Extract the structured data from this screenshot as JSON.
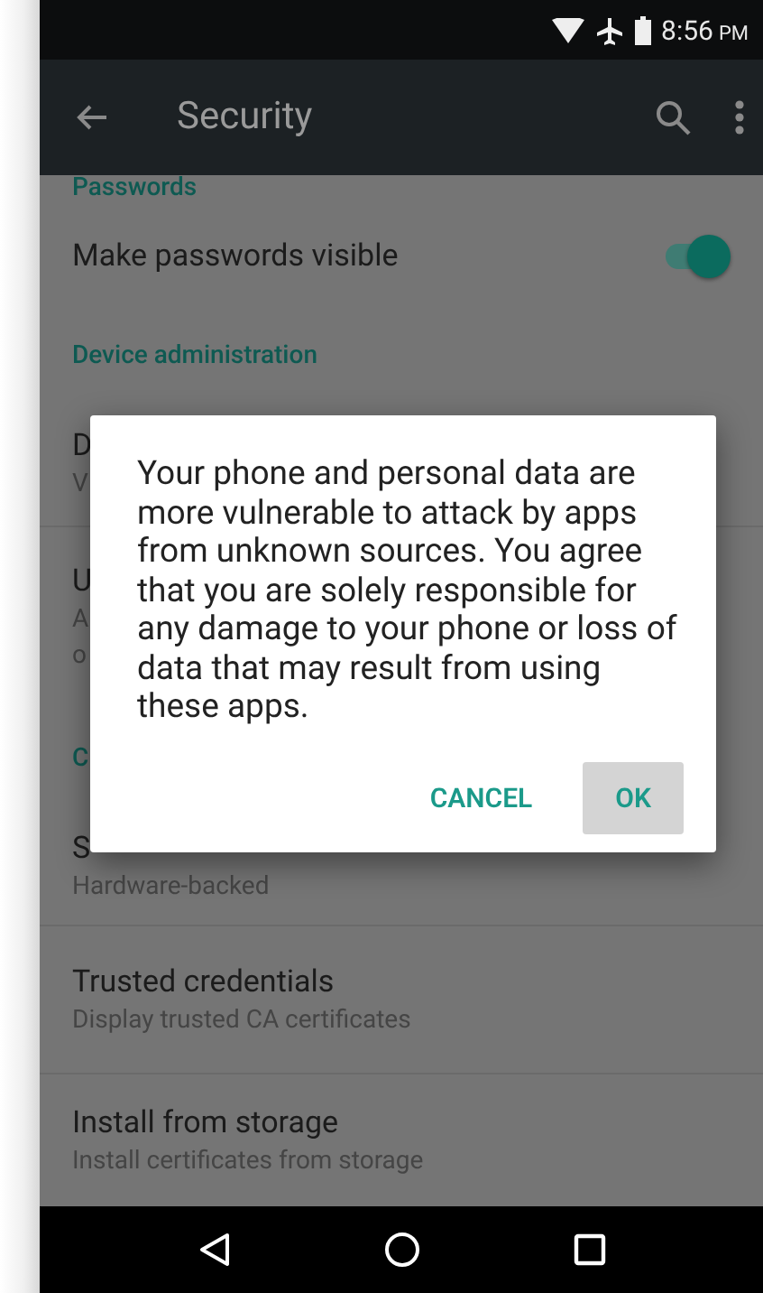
{
  "status_bar": {
    "time": "8:56",
    "meridiem": "PM"
  },
  "toolbar": {
    "title": "Security"
  },
  "list": [
    {
      "kind": "header",
      "text": "Passwords"
    },
    {
      "kind": "switch",
      "title": "Make passwords visible",
      "on": true
    },
    {
      "kind": "header",
      "text": "Device administration"
    },
    {
      "kind": "item",
      "title": "D",
      "subtitle_lines": [
        "V"
      ]
    },
    {
      "kind": "item",
      "title": "U",
      "subtitle_lines": [
        "A",
        "o"
      ]
    },
    {
      "kind": "header",
      "text": "C"
    },
    {
      "kind": "item",
      "title": "S",
      "subtitle_lines": [
        "Hardware-backed"
      ]
    },
    {
      "kind": "item",
      "title": "Trusted credentials",
      "subtitle_lines": [
        "Display trusted CA certificates"
      ]
    },
    {
      "kind": "item",
      "title": "Install from storage",
      "subtitle_lines": [
        "Install certificates from storage"
      ]
    }
  ],
  "dialog": {
    "message": "Your phone and personal data are more vulnerable to attack by apps from unknown sources. You agree that you are solely responsible for any damage to your phone or loss of data that may result from using these apps.",
    "buttons": [
      {
        "label": "CANCEL",
        "pressed": false
      },
      {
        "label": "OK",
        "pressed": true
      }
    ]
  }
}
